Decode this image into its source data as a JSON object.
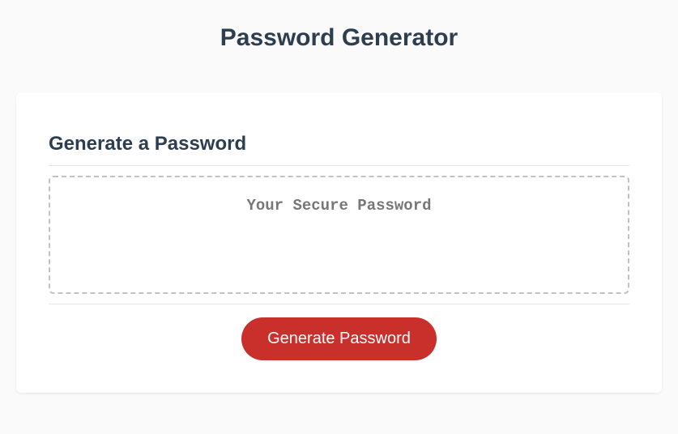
{
  "page": {
    "title": "Password Generator"
  },
  "card": {
    "heading": "Generate a Password",
    "password_placeholder": "Your Secure Password",
    "password_value": "",
    "generate_button_label": "Generate Password"
  }
}
